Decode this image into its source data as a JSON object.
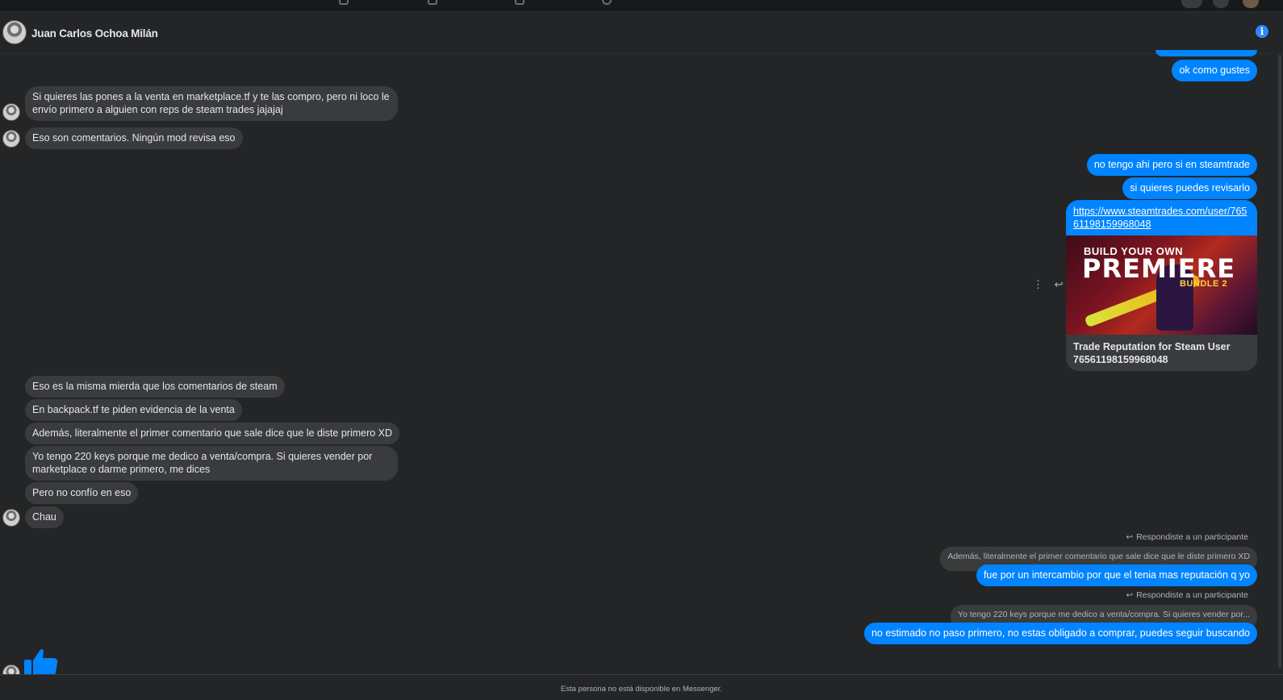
{
  "conversation": {
    "contact_name": "Juan Carlos Ochoa Milán",
    "info_icon": "info-icon"
  },
  "messages": {
    "out_ok": "ok como gustes",
    "in_1": "Si quieres las pones a la venta en marketplace.tf y te las compro, pero ni loco le envío primero a alguien con reps de steam trades jajajaj",
    "in_2": "Eso son comentarios. Ningún mod revisa eso",
    "out_1": "no tengo ahi pero si en steamtrade",
    "out_2": "si quieres puedes revisarlo",
    "link_url": "https://www.steamtrades.com/user/76561198159968048",
    "link_preview_title": "Trade Reputation for Steam User 76561198159968048",
    "in_3": "Eso es la misma mierda que los comentarios de steam",
    "in_4": "En backpack.tf te piden evidencia de la venta",
    "in_5": "Además, literalmente el primer comentario que sale dice que le diste primero XD",
    "in_6": "Yo tengo 220 keys porque me dedico a venta/compra. Si quieres vender por marketplace o darme primero, me dices",
    "in_7": "Pero no confío en eso",
    "in_8": "Chau",
    "reply_1": {
      "label": "Respondiste a un participante",
      "quoted": "Además, literalmente el primer comentario que sale dice que le diste primero XD",
      "text": "fue por un intercambio por que el tenia mas reputación q yo"
    },
    "reply_2": {
      "label": "Respondiste a un participante",
      "quoted": "Yo tengo 220 keys porque me dedico a venta/compra. Si quieres vender por...",
      "text": "no estimado no paso primero, no estas obligado a comprar, puedes seguir buscando"
    }
  },
  "link_image": {
    "line1": "BUILD YOUR OWN",
    "line2": "PREMIERE",
    "line3": "BUNDLE 2"
  },
  "footer": {
    "status_text": "Esta persona no está disponible en Messenger."
  },
  "colors": {
    "background": "#242526",
    "incoming_bubble": "#3a3b3c",
    "outgoing_bubble": "#0084ff",
    "accent": "#2d88ff"
  }
}
